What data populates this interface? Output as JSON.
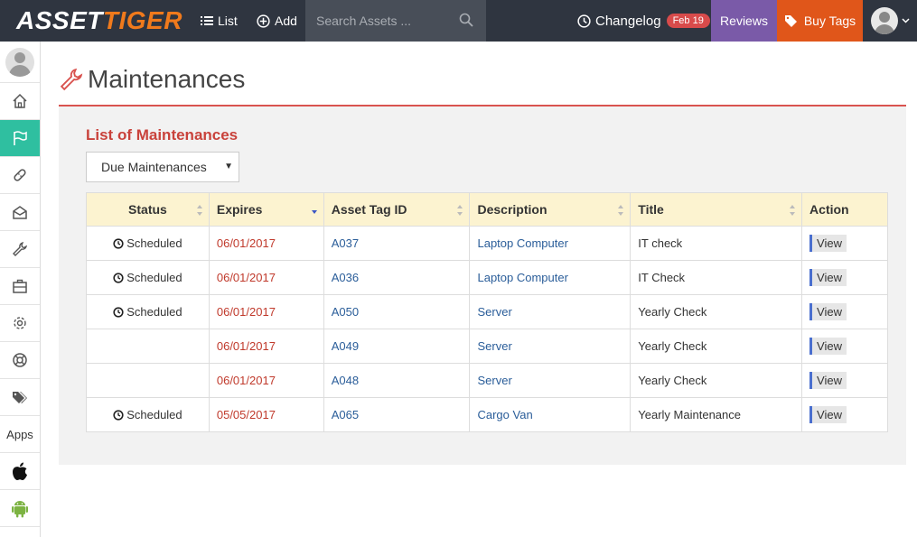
{
  "brand": {
    "part1": "ASSET",
    "part2": "TIGER"
  },
  "nav": {
    "list_label": "List",
    "add_label": "Add",
    "search_placeholder": "Search Assets ...",
    "changelog_label": "Changelog",
    "changelog_badge": "Feb 19",
    "reviews_label": "Reviews",
    "buy_tags_label": "Buy Tags"
  },
  "sidebar": {
    "apps_label": "Apps",
    "items": [
      "home-icon",
      "flag-icon",
      "bandage-icon",
      "envelope-open-icon",
      "wrench-icon",
      "briefcase-icon",
      "gear-icon",
      "lifebuoy-icon",
      "tags-icon"
    ],
    "active": "flag-icon"
  },
  "page": {
    "title": "Maintenances",
    "section_title": "List of Maintenances",
    "filter_selected": "Due Maintenances"
  },
  "table": {
    "headers": [
      "Status",
      "Expires",
      "Asset Tag ID",
      "Description",
      "Title",
      "Action"
    ],
    "rows": [
      {
        "status": "Scheduled",
        "expires": "06/01/2017",
        "tag": "A037",
        "description": "Laptop Computer",
        "title": "IT check",
        "action": "View"
      },
      {
        "status": "Scheduled",
        "expires": "06/01/2017",
        "tag": "A036",
        "description": "Laptop Computer",
        "title": "IT Check",
        "action": "View"
      },
      {
        "status": "Scheduled",
        "expires": "06/01/2017",
        "tag": "A050",
        "description": "Server",
        "title": "Yearly Check",
        "action": "View"
      },
      {
        "status": "",
        "expires": "06/01/2017",
        "tag": "A049",
        "description": "Server",
        "title": "Yearly Check",
        "action": "View"
      },
      {
        "status": "",
        "expires": "06/01/2017",
        "tag": "A048",
        "description": "Server",
        "title": "Yearly Check",
        "action": "View"
      },
      {
        "status": "Scheduled",
        "expires": "05/05/2017",
        "tag": "A065",
        "description": "Cargo Van",
        "title": "Yearly Maintenance",
        "action": "View"
      }
    ]
  },
  "colors": {
    "topbar": "#2f3540",
    "accent_teal": "#2fbfa0",
    "reviews": "#7a5aa8",
    "buy_tags": "#e0561a",
    "title_red": "#c9423b",
    "header_bg": "#fcf3d0"
  }
}
